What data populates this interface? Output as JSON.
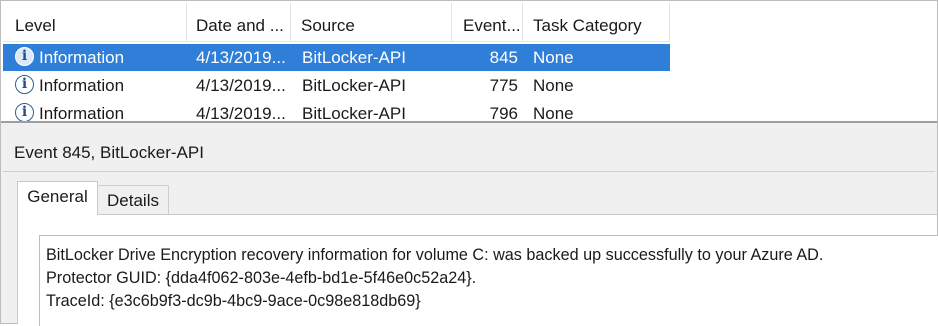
{
  "columns": {
    "level": "Level",
    "date": "Date and ...",
    "source": "Source",
    "event": "Event...",
    "task": "Task Category"
  },
  "rows": [
    {
      "level": "Information",
      "date": "4/13/2019...",
      "source": "BitLocker-API",
      "event": "845",
      "task": "None",
      "selected": true
    },
    {
      "level": "Information",
      "date": "4/13/2019...",
      "source": "BitLocker-API",
      "event": "775",
      "task": "None",
      "selected": false
    },
    {
      "level": "Information",
      "date": "4/13/2019...",
      "source": "BitLocker-API",
      "event": "796",
      "task": "None",
      "selected": false
    }
  ],
  "icon_glyph": "i",
  "detail": {
    "title": "Event 845, BitLocker-API",
    "tabs": {
      "general": "General",
      "details": "Details"
    },
    "message": [
      "BitLocker Drive Encryption recovery information for volume C: was backed up successfully to your Azure AD.",
      "Protector GUID: {dda4f062-803e-4efb-bd1e-5f46e0c52a24}.",
      "TraceId: {e3c6b9f3-dc9b-4bc9-9ace-0c98e818db69}"
    ]
  },
  "colors": {
    "selection": "#2f7fd9",
    "pane_background": "#f0f0f0",
    "info_icon": "#2c5f95"
  }
}
